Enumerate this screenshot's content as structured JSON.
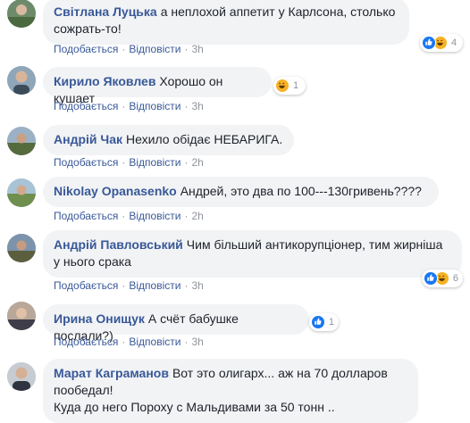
{
  "actions": {
    "like": "Подобається",
    "reply": "Відповісти",
    "dot": "·"
  },
  "comments": [
    {
      "author": "Світлана Луцька",
      "text_lines": [
        "а неплохой аппетит у Карлсона, столько",
        "сожрать-то!"
      ],
      "time": "3h",
      "reactions": {
        "icons": [
          "like",
          "haha"
        ],
        "count": "4"
      }
    },
    {
      "author": "Кирило Яковлев",
      "text_lines": [
        "Хорошо он кушает"
      ],
      "time": "3h",
      "reactions": {
        "icons": [
          "haha"
        ],
        "count": "1"
      }
    },
    {
      "author": "Андрій Чак",
      "text_lines": [
        "Нехило обідає НЕБАРИГА."
      ],
      "time": "2h"
    },
    {
      "author": "Nikolay Opanasenko",
      "text_lines": [
        "Андрей, это два по 100---130гривень????"
      ],
      "time": "2h"
    },
    {
      "author": "Андрій Павловський",
      "text_lines": [
        "Чим більший антикорупціонер, тим жирніша",
        "у нього срака"
      ],
      "time": "3h",
      "reactions": {
        "icons": [
          "like",
          "haha"
        ],
        "count": "6"
      }
    },
    {
      "author": "Ирина Онищук",
      "text_lines": [
        "А счёт бабушке послали?)"
      ],
      "time": "3h",
      "reactions": {
        "icons": [
          "like"
        ],
        "count": "1"
      }
    },
    {
      "author": "Марат Каграманов",
      "text_lines": [
        "Вот это олигарх... аж на 70 долларов",
        "пообедал!",
        "Куда до него Пороху с Мальдивами за 50 тонн .."
      ]
    }
  ],
  "colors": {
    "link": "#385898",
    "meta": "#90949c",
    "bubble": "#f2f3f5",
    "like": "#1877f2",
    "haha": "#f7b125"
  }
}
